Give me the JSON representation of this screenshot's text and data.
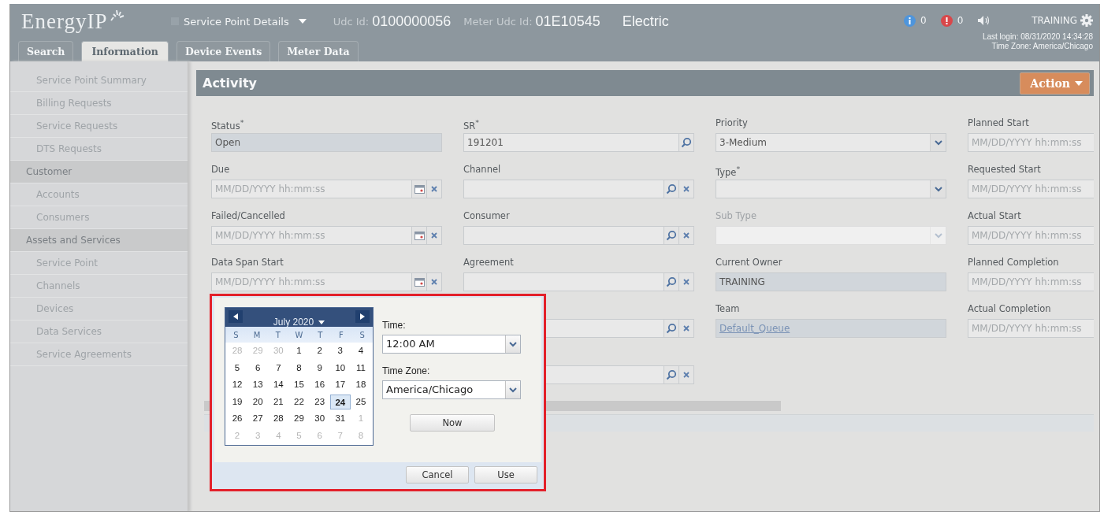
{
  "header": {
    "logo": "EnergyIP",
    "page_menu": "Service Point Details",
    "udc_id_label": "Udc Id:",
    "udc_id": "0100000056",
    "meter_udc_id_label": "Meter Udc Id:",
    "meter_udc_id": "01E10545",
    "commodity": "Electric",
    "info_count": "0",
    "alert_count": "0",
    "user": "TRAINING",
    "last_login": "Last login: 08/31/2020 14:34:28",
    "time_zone": "Time Zone: America/Chicago"
  },
  "tabs": [
    {
      "label": "Search",
      "selected": false
    },
    {
      "label": "Information",
      "selected": true
    },
    {
      "label": "Device Events",
      "selected": false
    },
    {
      "label": "Meter Data",
      "selected": false
    }
  ],
  "sidebar": {
    "items": [
      {
        "label": "Service Point Summary",
        "kind": "item"
      },
      {
        "label": "Billing Requests",
        "kind": "item"
      },
      {
        "label": "Service Requests",
        "kind": "item"
      },
      {
        "label": "DTS Requests",
        "kind": "item"
      },
      {
        "label": "Customer",
        "kind": "group"
      },
      {
        "label": "Accounts",
        "kind": "item"
      },
      {
        "label": "Consumers",
        "kind": "item"
      },
      {
        "label": "Assets and Services",
        "kind": "group"
      },
      {
        "label": "Service Point",
        "kind": "item"
      },
      {
        "label": "Channels",
        "kind": "item"
      },
      {
        "label": "Devices",
        "kind": "item"
      },
      {
        "label": "Data Services",
        "kind": "item"
      },
      {
        "label": "Service Agreements",
        "kind": "item"
      }
    ]
  },
  "panel": {
    "title": "Activity",
    "action_button": "Action",
    "columns": [
      [
        {
          "label": "Status$^{*}$",
          "kind": "text",
          "value": "Open"
        },
        {
          "label": "Due",
          "kind": "date",
          "placeholder": "MM/DD/YYYY hh:mm:ss"
        },
        {
          "label": "Failed/Cancelled",
          "kind": "date",
          "placeholder": "MM/DD/YYYY hh:mm:ss"
        },
        {
          "label": "Data Span Start",
          "kind": "date",
          "placeholder": "MM/DD/YYYY hh:mm:ss"
        }
      ],
      [
        {
          "label": "SR$^{*}$",
          "kind": "search",
          "value": "191201"
        },
        {
          "label": "Channel",
          "kind": "lookup"
        },
        {
          "label": "Consumer",
          "kind": "lookup"
        },
        {
          "label": "Agreement",
          "kind": "lookup"
        },
        {
          "kind": "lookup"
        },
        {
          "kind": "lookup"
        }
      ],
      [
        {
          "label": "Priority",
          "kind": "select",
          "value": "3-Medium",
          "disabled": false
        },
        {
          "label": "Type$^{*}$",
          "kind": "select",
          "disabled": false
        },
        {
          "label": "Sub Type",
          "kind": "select",
          "disabled": true
        },
        {
          "label": "Current Owner",
          "kind": "text",
          "value": "TRAINING"
        },
        {
          "label": "Team",
          "kind": "link",
          "value": "Default_Queue"
        }
      ],
      [
        {
          "label": "Planned Start",
          "kind": "plain",
          "placeholder": "MM/DD/YYYY hh:mm:ss"
        },
        {
          "label": "Requested Start",
          "kind": "plain",
          "placeholder": "MM/DD/YYYY hh:mm:ss"
        },
        {
          "label": "Actual Start",
          "kind": "plain",
          "placeholder": "MM/DD/YYYY hh:mm:ss"
        },
        {
          "label": "Planned Completion",
          "kind": "plain",
          "placeholder": "MM/DD/YYYY hh:mm:ss"
        },
        {
          "label": "Actual Completion",
          "kind": "plain",
          "placeholder": "MM/DD/YYYY hh:mm:ss"
        }
      ]
    ]
  },
  "date_picker": {
    "month": "July 2020",
    "weekdays": [
      "S",
      "M",
      "T",
      "W",
      "T",
      "F",
      "S"
    ],
    "weeks": [
      [
        {
          "label": "28",
          "muted": true,
          "selected": false
        },
        {
          "label": "29",
          "muted": true,
          "selected": false
        },
        {
          "label": "30",
          "muted": true,
          "selected": false
        },
        {
          "label": "1",
          "muted": false,
          "selected": false
        },
        {
          "label": "2",
          "muted": false,
          "selected": false
        },
        {
          "label": "3",
          "muted": false,
          "selected": false
        },
        {
          "label": "4",
          "muted": false,
          "selected": false
        }
      ],
      [
        {
          "label": "5",
          "muted": false,
          "selected": false
        },
        {
          "label": "6",
          "muted": false,
          "selected": false
        },
        {
          "label": "7",
          "muted": false,
          "selected": false
        },
        {
          "label": "8",
          "muted": false,
          "selected": false
        },
        {
          "label": "9",
          "muted": false,
          "selected": false
        },
        {
          "label": "10",
          "muted": false,
          "selected": false
        },
        {
          "label": "11",
          "muted": false,
          "selected": false
        }
      ],
      [
        {
          "label": "12",
          "muted": false,
          "selected": false
        },
        {
          "label": "13",
          "muted": false,
          "selected": false
        },
        {
          "label": "14",
          "muted": false,
          "selected": false
        },
        {
          "label": "15",
          "muted": false,
          "selected": false
        },
        {
          "label": "16",
          "muted": false,
          "selected": false
        },
        {
          "label": "17",
          "muted": false,
          "selected": false
        },
        {
          "label": "18",
          "muted": false,
          "selected": false
        }
      ],
      [
        {
          "label": "19",
          "muted": false,
          "selected": false
        },
        {
          "label": "20",
          "muted": false,
          "selected": false
        },
        {
          "label": "21",
          "muted": false,
          "selected": false
        },
        {
          "label": "22",
          "muted": false,
          "selected": false
        },
        {
          "label": "23",
          "muted": false,
          "selected": false
        },
        {
          "label": "24",
          "muted": false,
          "selected": true
        },
        {
          "label": "25",
          "muted": false,
          "selected": false
        }
      ],
      [
        {
          "label": "26",
          "muted": false,
          "selected": false
        },
        {
          "label": "27",
          "muted": false,
          "selected": false
        },
        {
          "label": "28",
          "muted": false,
          "selected": false
        },
        {
          "label": "29",
          "muted": false,
          "selected": false
        },
        {
          "label": "30",
          "muted": false,
          "selected": false
        },
        {
          "label": "31",
          "muted": false,
          "selected": false
        },
        {
          "label": "1",
          "muted": true,
          "selected": false
        }
      ],
      [
        {
          "label": "2",
          "muted": true,
          "selected": false
        },
        {
          "label": "3",
          "muted": true,
          "selected": false
        },
        {
          "label": "4",
          "muted": true,
          "selected": false
        },
        {
          "label": "5",
          "muted": true,
          "selected": false
        },
        {
          "label": "6",
          "muted": true,
          "selected": false
        },
        {
          "label": "7",
          "muted": true,
          "selected": false
        },
        {
          "label": "8",
          "muted": true,
          "selected": false
        }
      ]
    ],
    "time_label": "Time:",
    "time": "12:00 AM",
    "time_zone_label": "Time Zone:",
    "time_zone": "America/Chicago",
    "now_button": "Now",
    "buttons": [
      "Cancel",
      "Use"
    ]
  }
}
